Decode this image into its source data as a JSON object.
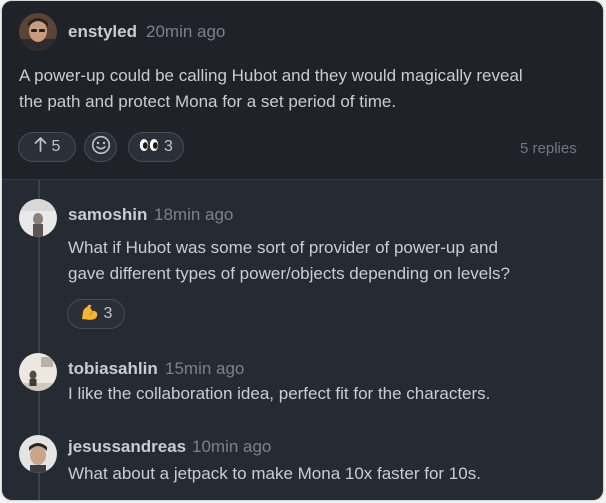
{
  "colors": {
    "page_background": "#f3f3f3",
    "top_card_background": "#1f2229",
    "thread_background": "#262b33",
    "text_primary": "#c9cdd2",
    "text_muted": "#7b8089"
  },
  "post": {
    "author": "enstyled",
    "time": "20min ago",
    "avatar_icon": "avatar-photo",
    "body_lines": [
      "A power-up could be calling Hubot and they would magically reveal",
      "the path and protect Mona for a set period of time."
    ],
    "reactions": [
      {
        "icon": "upvote-arrow-icon",
        "count": "5"
      },
      {
        "icon": "smiley-add-reaction-icon",
        "count": ""
      },
      {
        "icon": "eyes-emoji-icon",
        "count": "3"
      }
    ],
    "replies_label": "5 replies"
  },
  "replies": [
    {
      "author": "samoshin",
      "time": "18min ago",
      "body_lines": [
        "What if Hubot was some sort of provider of power-up and",
        "gave different types of power/objects depending on levels?"
      ],
      "reaction": {
        "icon": "flexed-biceps-emoji-icon",
        "count": "3"
      }
    },
    {
      "author": "tobiasahlin",
      "time": "15min ago",
      "body_lines": [
        "I like the collaboration idea, perfect fit for the characters."
      ]
    },
    {
      "author": "jesussandreas",
      "time": "10min ago",
      "body_lines": [
        "What about a jetpack to make Mona 10x faster for 10s."
      ]
    }
  ]
}
